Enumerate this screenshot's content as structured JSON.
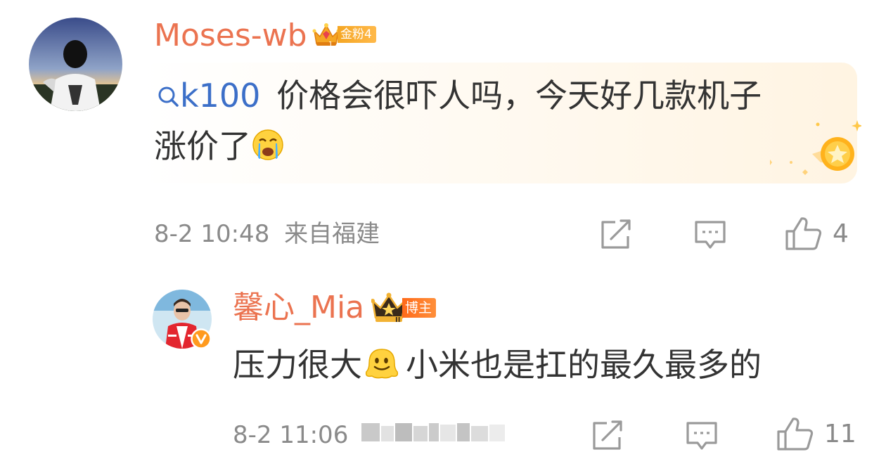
{
  "comment1": {
    "username": "Moses-wb",
    "badge_label": "金粉4",
    "topic": "k100",
    "line1": "价格会很吓人吗，今天好几款机子",
    "line2": "涨价了",
    "emoji": "crying-face",
    "date": "8-2 10:48",
    "location": "来自福建",
    "like_count": "4"
  },
  "comment2": {
    "username": "馨心_Mia",
    "badge_label": "博主",
    "text_part1": "压力很大",
    "emoji": "melting-face",
    "text_part2": "小米也是扛的最久最多的",
    "date": "8-2 11:06",
    "location_blurred": true,
    "like_count": "11"
  },
  "colors": {
    "username": "#eb7350",
    "topic_link": "#3c6fc8",
    "meta_text": "#8a8a8a",
    "badge_gold": "#f5a623",
    "badge_orange": "#ff7a2a"
  },
  "icons": [
    "search-icon",
    "crown-icon",
    "crying-emoji-icon",
    "fan-star-medal-icon",
    "share-icon",
    "comment-icon",
    "like-icon",
    "blogger-crown-icon",
    "verified-v-icon",
    "melting-emoji-icon"
  ]
}
